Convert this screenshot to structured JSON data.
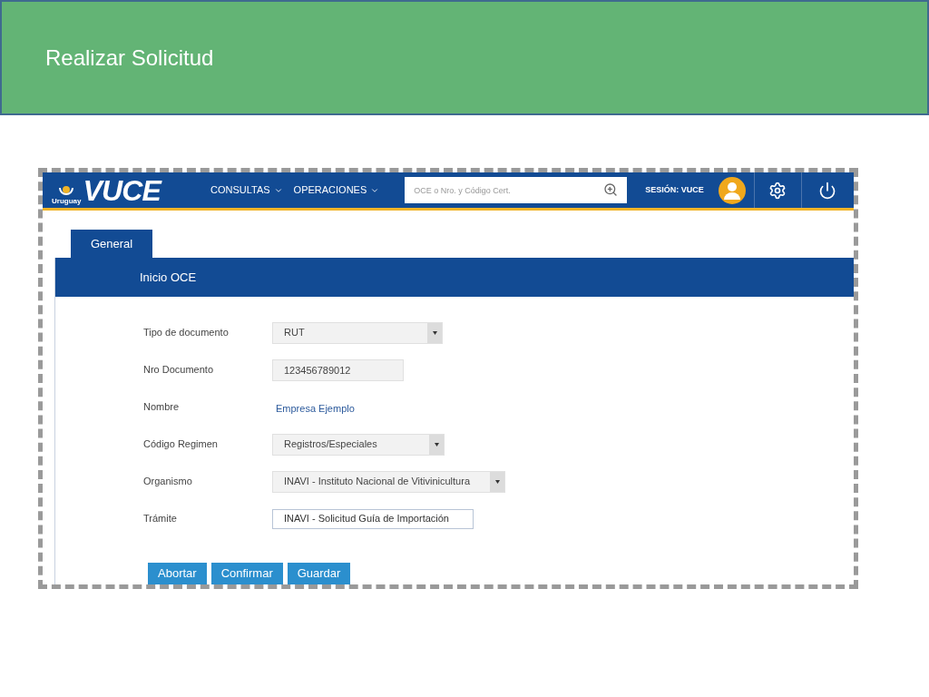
{
  "slide": {
    "title": "Realizar Solicitud"
  },
  "navbar": {
    "logo_caption": "Uruguay",
    "logo_text": "VUCE",
    "menus": [
      {
        "label": "CONSULTAS"
      },
      {
        "label": "OPERACIONES"
      }
    ],
    "search": {
      "placeholder": "OCE o Nro. y Código Cert."
    },
    "session": "SESIÓN: VUCE"
  },
  "tabs": [
    {
      "label": "General",
      "selected": true
    }
  ],
  "section": {
    "title": "Inicio OCE"
  },
  "fields": [
    {
      "label": "Tipo de documento",
      "kind": "select",
      "value": "RUT"
    },
    {
      "label": "Nro Documento",
      "kind": "text",
      "value": "123456789012"
    },
    {
      "label": "Nombre",
      "kind": "link",
      "value": "Empresa Ejemplo"
    },
    {
      "label": "Código Regimen",
      "kind": "select",
      "value": "Registros/Especiales"
    },
    {
      "label": "Organismo",
      "kind": "select",
      "value": "INAVI - Instituto Nacional de Vitivinicultura"
    },
    {
      "label": "Trámite",
      "kind": "list",
      "value": "INAVI - Solicitud Guía de Importación"
    }
  ],
  "buttons": [
    {
      "label": "Abortar"
    },
    {
      "label": "Confirmar"
    },
    {
      "label": "Guardar"
    }
  ]
}
